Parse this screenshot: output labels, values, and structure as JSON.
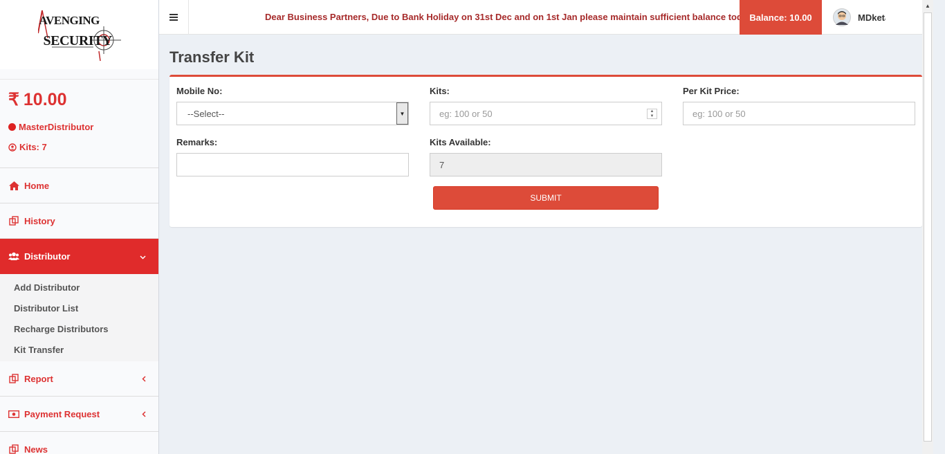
{
  "brand": {
    "line1": "VENGING",
    "line1_prefix": "A",
    "line2": "SECURITY"
  },
  "sidebar": {
    "balance": "10.00",
    "currency_symbol": "₹",
    "role": "MasterDistributor",
    "kits": "Kits: 7",
    "menu": [
      {
        "label": "Home",
        "icon": "home-icon"
      },
      {
        "label": "History",
        "icon": "copy-icon"
      },
      {
        "label": "Distributor",
        "icon": "users-icon",
        "active": true
      },
      {
        "label": "Report",
        "icon": "copy-icon"
      },
      {
        "label": "Payment Request",
        "icon": "money-icon"
      },
      {
        "label": "News",
        "icon": "copy-icon"
      }
    ],
    "submenu": [
      "Add Distributor",
      "Distributor List",
      "Recharge Distributors",
      "Kit Transfer"
    ]
  },
  "topbar": {
    "marquee": "Dear Business Partners, Due to Bank Holiday on 31st Dec and on 1st Jan please maintain sufficient balance today",
    "balance_label": "Balance: 10.00",
    "user_name": "MDketan"
  },
  "page": {
    "title": "Transfer Kit",
    "form": {
      "mobile_label": "Mobile No:",
      "mobile_value": "--Select--",
      "kits_label": "Kits:",
      "kits_placeholder": "eg: 100 or 50",
      "price_label": "Per Kit Price:",
      "price_placeholder": "eg: 100 or 50",
      "remarks_label": "Remarks:",
      "remarks_value": "",
      "available_label": "Kits Available:",
      "available_value": "7",
      "submit_label": "SUBMIT"
    }
  },
  "colors": {
    "accent": "#dd4b39",
    "sidebar_active": "#e02b2b",
    "text_red": "#dd3232"
  }
}
